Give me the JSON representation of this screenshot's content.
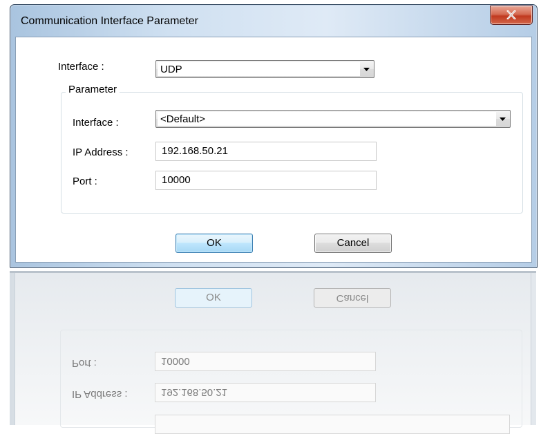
{
  "window": {
    "title": "Communication Interface Parameter",
    "close_label": "x"
  },
  "form": {
    "interface_label": "Interface :",
    "interface_value": "UDP",
    "group_title": "Parameter",
    "param_interface_label": "Interface :",
    "param_interface_value": "<Default>",
    "ip_label": "IP Address :",
    "ip_value": "192.168.50.21",
    "port_label": "Port :",
    "port_value": "10000"
  },
  "buttons": {
    "ok_label": "OK",
    "cancel_label": "Cancel"
  },
  "reflection": {
    "ok_label": "OK",
    "cancel_label": "Cancel",
    "port_label": "Port :",
    "port_value": "10000",
    "ip_label": "IP Address :",
    "ip_value": "192.168.50.21"
  }
}
